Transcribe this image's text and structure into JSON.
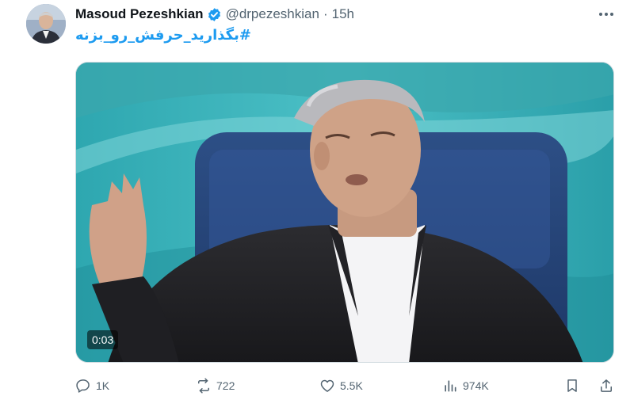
{
  "author": {
    "display_name": "Masoud Pezeshkian",
    "handle": "@drpezeshkian",
    "separator": "·",
    "time": "15h",
    "verified_badge": "verified-check-icon",
    "badge_color": "#1d9bf0"
  },
  "tweet": {
    "hashtag": "#بگذارید_حرفش_رو_بزنه",
    "hashtag_color": "#1d9bf0"
  },
  "media": {
    "type": "video",
    "duration": "0:03"
  },
  "actions": {
    "replies": "1K",
    "reposts": "722",
    "likes": "5.5K",
    "views": "974K",
    "icons": [
      "reply-icon",
      "repost-icon",
      "like-icon",
      "views-icon",
      "bookmark-icon",
      "share-icon"
    ]
  },
  "menu_icon": "more-options-icon"
}
